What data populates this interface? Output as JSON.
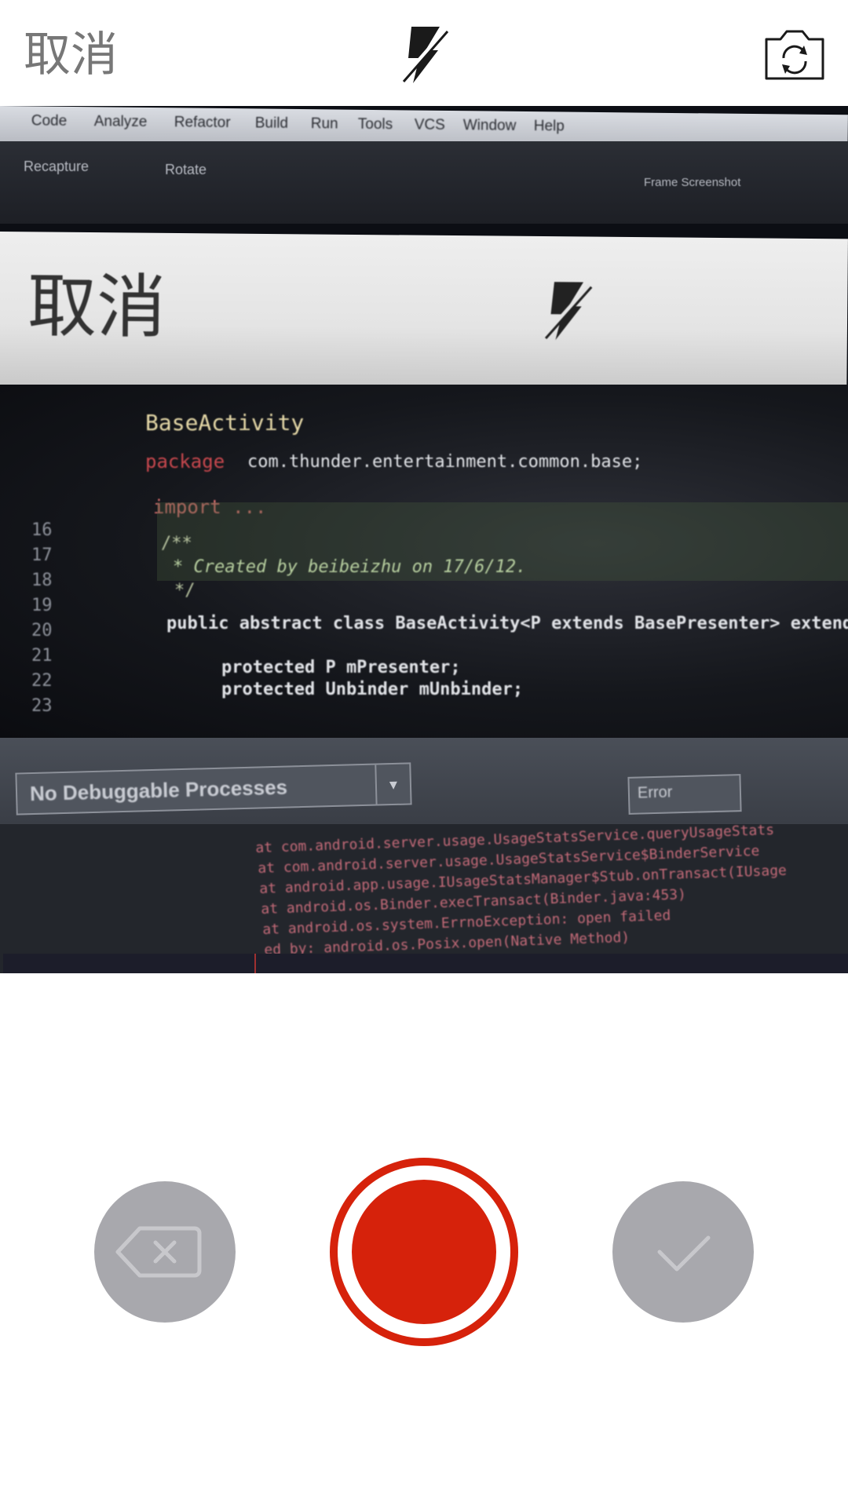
{
  "top_bar": {
    "cancel_label": "取消",
    "flash_icon": "flash-off-icon",
    "flip_camera_icon": "flip-camera-icon"
  },
  "viewfinder": {
    "menubar": [
      "Code",
      "Analyze",
      "Refactor",
      "Build",
      "Run",
      "Tools",
      "VCS",
      "Window",
      "Help"
    ],
    "toolbar": {
      "recapture": "Recapture",
      "rotate": "Rotate",
      "frame_screenshot": "Frame Screenshot"
    },
    "phone_screen": {
      "cancel_label": "取消"
    },
    "code": {
      "class_name": "BaseActivity",
      "package_keyword": "package",
      "package_name": "com.thunder.entertainment.common.base;",
      "import_line": "import ...",
      "line_numbers": "16\n17\n18\n19\n20\n21\n22\n23",
      "comment_open": "/**",
      "comment_body": "* Created by beibeizhu on 17/6/12.",
      "comment_close": "*/",
      "class_decl": "public abstract class BaseActivity<P extends BasePresenter> extends Ro",
      "field_presenter": "protected P mPresenter;",
      "field_unbinder": "protected Unbinder mUnbinder;"
    },
    "console": {
      "process_label": "No Debuggable Processes",
      "level_label": "Error",
      "log_lines": [
        "at com.android.server.usage.UsageStatsService.queryUsageStats",
        "at com.android.server.usage.UsageStatsService$BinderService",
        "at android.app.usage.IUsageStatsManager$Stub.onTransact(IUsage",
        "at android.os.Binder.execTransact(Binder.java:453)",
        "at android.os.system.ErrnoException: open failed",
        "ed by: android.os.Posix.open(Native Method)"
      ]
    }
  },
  "controls": {
    "delete_icon": "backspace-icon",
    "record_icon": "record-icon",
    "confirm_icon": "checkmark-icon"
  },
  "colors": {
    "accent_red": "#d6220b",
    "disabled_gray": "#a8a8ad",
    "cancel_text": "#777777"
  }
}
